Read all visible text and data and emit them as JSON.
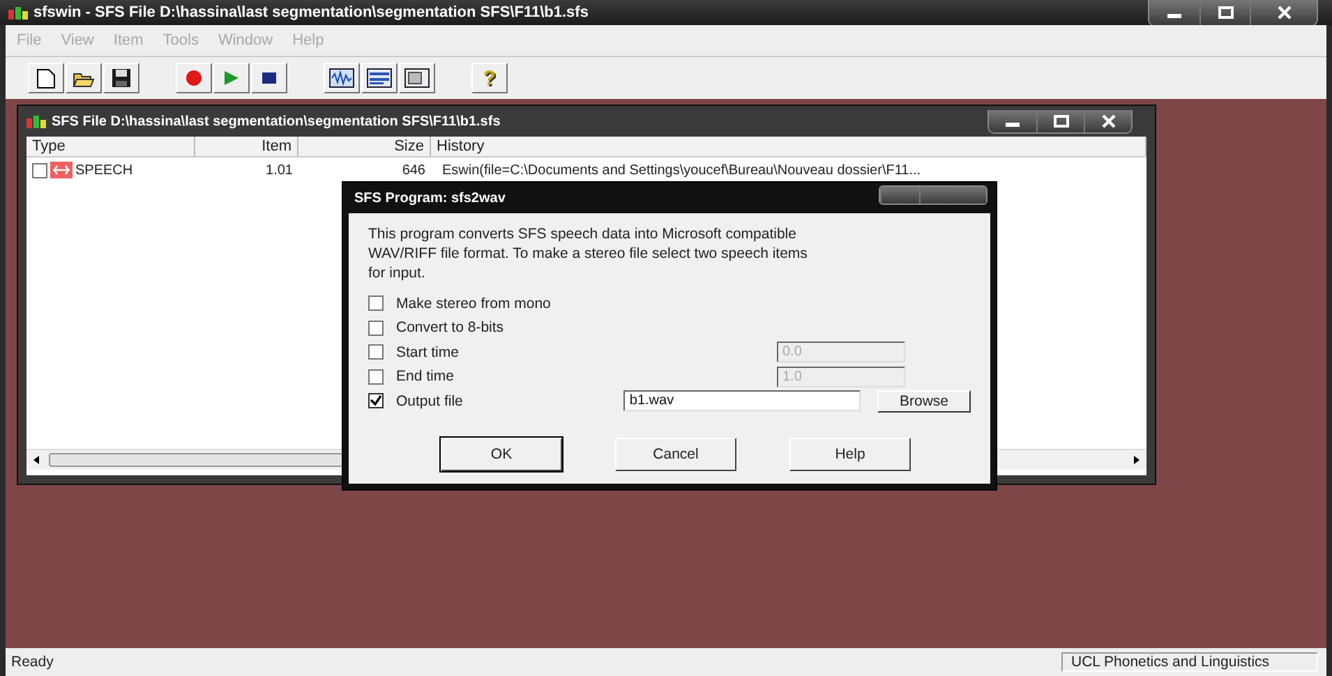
{
  "app_window": {
    "title": "sfswin - SFS File D:\\hassina\\last segmentation\\segmentation SFS\\F11\\b1.sfs"
  },
  "menu": [
    {
      "label": "File",
      "disabled": true
    },
    {
      "label": "View",
      "disabled": true
    },
    {
      "label": "Item",
      "disabled": true
    },
    {
      "label": "Tools",
      "disabled": true
    },
    {
      "label": "Window",
      "disabled": true
    },
    {
      "label": "Help",
      "disabled": true
    }
  ],
  "toolbar": [
    [
      {
        "kind": "new"
      },
      {
        "kind": "open"
      },
      {
        "kind": "save"
      }
    ],
    [
      {
        "kind": "record"
      },
      {
        "kind": "play"
      },
      {
        "kind": "stop"
      }
    ],
    [
      {
        "kind": "wave"
      },
      {
        "kind": "list"
      },
      {
        "kind": "panel"
      }
    ],
    [
      {
        "kind": "help",
        "label": "?"
      }
    ]
  ],
  "file_window": {
    "title": "SFS File D:\\hassina\\last segmentation\\segmentation SFS\\F11\\b1.sfs",
    "columns": [
      "Type",
      "Item",
      "Size",
      "History"
    ],
    "rows": [
      {
        "checked": false,
        "type": "SPEECH",
        "item": "1.01",
        "size": "646",
        "history": "Eswin(file=C:\\Documents and Settings\\youcef\\Bureau\\Nouveau dossier\\F11..."
      }
    ]
  },
  "dialog": {
    "title": "SFS Program: sfs2wav",
    "description": "This program converts SFS speech data into Microsoft compatible WAV/RIFF file format.  To make a stereo file select two speech items for input.",
    "options": [
      {
        "label": "Make stereo from mono",
        "checked": false
      },
      {
        "label": "Convert to 8-bits",
        "checked": false
      },
      {
        "label": "Start time",
        "checked": false,
        "field": {
          "value": "0.0",
          "disabled": true
        }
      },
      {
        "label": "End time",
        "checked": false,
        "field": {
          "value": "1.0",
          "disabled": true
        }
      },
      {
        "label": "Output file",
        "checked": true,
        "field": {
          "value": "b1.wav",
          "disabled": false
        },
        "button": "Browse"
      }
    ],
    "buttons": [
      {
        "label": "OK",
        "default": true
      },
      {
        "label": "Cancel",
        "default": false
      },
      {
        "label": "Help",
        "default": false
      }
    ]
  },
  "status_bar": {
    "left": "Ready",
    "right": "UCL Phonetics and Linguistics"
  }
}
